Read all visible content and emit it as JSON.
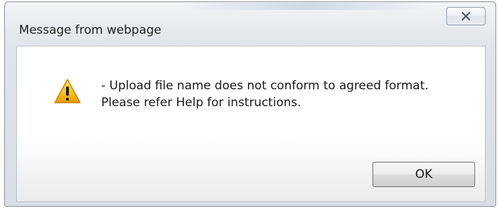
{
  "dialog": {
    "title": "Message from webpage",
    "close_icon": "close-icon",
    "icon": "warning-icon",
    "message_lines": [
      "- Upload file name does not conform to agreed format.",
      "Please refer Help for instructions."
    ],
    "ok_label": "OK"
  }
}
